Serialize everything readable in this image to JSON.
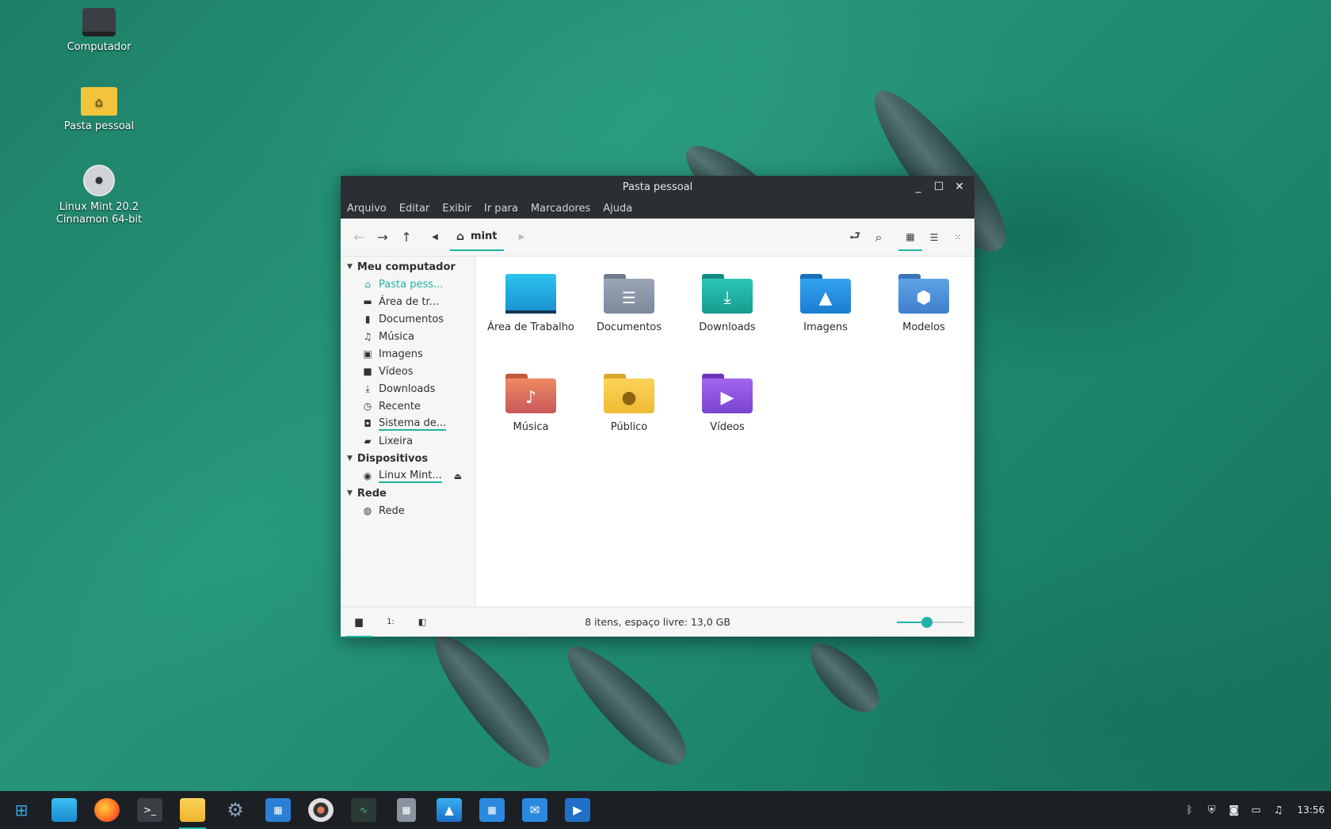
{
  "desktop": {
    "icons": [
      {
        "label": "Computador",
        "icon": "computer-icon"
      },
      {
        "label": "Pasta pessoal",
        "icon": "home-folder-icon"
      },
      {
        "label_line1": "Linux Mint 20.2",
        "label_line2": "Cinnamon 64-bit",
        "icon": "disc-icon"
      }
    ]
  },
  "window": {
    "title": "Pasta pessoal",
    "menu": [
      "Arquivo",
      "Editar",
      "Exibir",
      "Ir para",
      "Marcadores",
      "Ajuda"
    ],
    "breadcrumb": "mint",
    "sidebar": {
      "sections": [
        {
          "label": "Meu computador",
          "items": [
            {
              "label": "Pasta pess...",
              "icon": "home-icon",
              "active": true
            },
            {
              "label": "Área de tr...",
              "icon": "desktop-icon"
            },
            {
              "label": "Documentos",
              "icon": "document-icon"
            },
            {
              "label": "Música",
              "icon": "music-icon"
            },
            {
              "label": "Imagens",
              "icon": "image-icon"
            },
            {
              "label": "Vídeos",
              "icon": "video-icon"
            },
            {
              "label": "Downloads",
              "icon": "download-icon"
            },
            {
              "label": "Recente",
              "icon": "clock-icon"
            },
            {
              "label": "Sistema de...",
              "icon": "drive-icon"
            },
            {
              "label": "Lixeira",
              "icon": "trash-icon"
            }
          ]
        },
        {
          "label": "Dispositivos",
          "items": [
            {
              "label": "Linux Mint...",
              "icon": "disc-icon"
            }
          ]
        },
        {
          "label": "Rede",
          "items": [
            {
              "label": "Rede",
              "icon": "network-icon"
            }
          ]
        }
      ]
    },
    "files": [
      {
        "label": "Área de Trabalho",
        "icon": "desktop-folder-icon",
        "color": "#1aa9d9"
      },
      {
        "label": "Documentos",
        "icon": "documents-folder-icon",
        "color": "#8b96a8"
      },
      {
        "label": "Downloads",
        "icon": "downloads-folder-icon",
        "color": "#1fb3a5"
      },
      {
        "label": "Imagens",
        "icon": "pictures-folder-icon",
        "color": "#1f8fe0"
      },
      {
        "label": "Modelos",
        "icon": "templates-folder-icon",
        "color": "#4a8fd6"
      },
      {
        "label": "Música",
        "icon": "music-folder-icon",
        "color": "#e07a5a"
      },
      {
        "label": "Público",
        "icon": "public-folder-icon",
        "color": "#f2c53d"
      },
      {
        "label": "Vídeos",
        "icon": "videos-folder-icon",
        "color": "#8a4fd8"
      }
    ],
    "status": "8 itens, espaço livre: 13,0 GB",
    "zoom_level": 0.45
  },
  "taskbar": {
    "apps": [
      "menu-icon",
      "show-desktop-icon",
      "firefox-icon",
      "terminal-icon",
      "files-icon",
      "settings-icon",
      "software-store-icon",
      "rhythmbox-icon",
      "system-monitor-icon",
      "calculator-icon",
      "image-viewer-icon",
      "calendar-icon",
      "mail-icon",
      "video-player-icon"
    ],
    "clock": "13:56"
  },
  "colors": {
    "accent": "#1fb3a5",
    "titlebar": "#2b2f33",
    "taskbar": "#1c2024"
  }
}
